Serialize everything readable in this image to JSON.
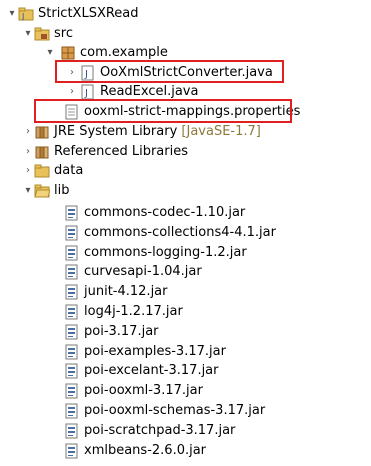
{
  "tree": {
    "project": "StrictXLSXRead",
    "src": "src",
    "package": "com.example",
    "files": {
      "converter": "OoXmlStrictConverter.java",
      "readexcel": "ReadExcel.java",
      "properties": "ooxml-strict-mappings.properties"
    },
    "jre": {
      "label": "JRE System Library",
      "tag": "[JavaSE-1.7]"
    },
    "referenced": "Referenced Libraries",
    "data": "data",
    "lib": "lib",
    "jars": [
      "commons-codec-1.10.jar",
      "commons-collections4-4.1.jar",
      "commons-logging-1.2.jar",
      "curvesapi-1.04.jar",
      "junit-4.12.jar",
      "log4j-1.2.17.jar",
      "poi-3.17.jar",
      "poi-examples-3.17.jar",
      "poi-excelant-3.17.jar",
      "poi-ooxml-3.17.jar",
      "poi-ooxml-schemas-3.17.jar",
      "poi-scratchpad-3.17.jar",
      "xmlbeans-2.6.0.jar"
    ]
  },
  "colors": {
    "highlight": "#e02020",
    "folder": "#e8c15a",
    "jar": "#4a6fa5"
  }
}
